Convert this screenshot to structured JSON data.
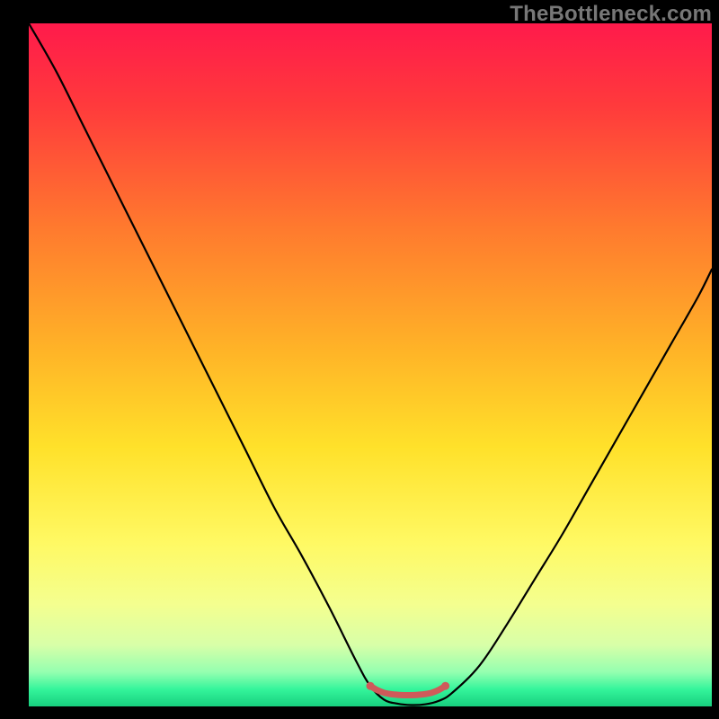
{
  "watermark": "TheBottleneck.com",
  "chart_data": {
    "type": "line",
    "title": "",
    "xlabel": "",
    "ylabel": "",
    "xlim": [
      0,
      100
    ],
    "ylim": [
      0,
      100
    ],
    "background_gradient": {
      "stops": [
        {
          "pos": 0.0,
          "color": "#ff1a4b"
        },
        {
          "pos": 0.12,
          "color": "#ff3a3c"
        },
        {
          "pos": 0.3,
          "color": "#ff7a2e"
        },
        {
          "pos": 0.48,
          "color": "#ffb427"
        },
        {
          "pos": 0.62,
          "color": "#ffe12a"
        },
        {
          "pos": 0.76,
          "color": "#fff963"
        },
        {
          "pos": 0.85,
          "color": "#f4ff8f"
        },
        {
          "pos": 0.91,
          "color": "#d8ffa8"
        },
        {
          "pos": 0.95,
          "color": "#94ffb0"
        },
        {
          "pos": 0.975,
          "color": "#34f59b"
        },
        {
          "pos": 1.0,
          "color": "#17cf7e"
        }
      ]
    },
    "series": [
      {
        "name": "bottleneck-v",
        "stroke": "#000000",
        "width": 2.2,
        "x": [
          0.0,
          4.0,
          8.0,
          12.0,
          16.0,
          20.0,
          24.0,
          28.0,
          32.0,
          36.0,
          40.0,
          44.0,
          48.0,
          50.0,
          52.0,
          54.0,
          56.0,
          58.0,
          60.0,
          62.0,
          66.0,
          70.0,
          74.0,
          78.0,
          82.0,
          86.0,
          90.0,
          94.0,
          98.0,
          100.0
        ],
        "y": [
          100.0,
          93.0,
          85.0,
          77.0,
          69.0,
          61.0,
          53.0,
          45.0,
          37.0,
          29.0,
          22.0,
          14.5,
          6.5,
          3.0,
          1.0,
          0.4,
          0.2,
          0.3,
          0.8,
          2.0,
          6.0,
          12.0,
          18.5,
          25.0,
          32.0,
          39.0,
          46.0,
          53.0,
          60.0,
          64.0
        ]
      },
      {
        "name": "valley-floor-marker",
        "stroke": "#cf5a5a",
        "width": 7.0,
        "x": [
          50.0,
          51.0,
          52.0,
          53.0,
          54.0,
          55.0,
          56.0,
          57.0,
          58.0,
          59.0,
          60.0,
          61.0
        ],
        "y": [
          3.0,
          2.4,
          2.0,
          1.8,
          1.7,
          1.65,
          1.65,
          1.7,
          1.8,
          2.0,
          2.4,
          3.0
        ]
      }
    ]
  }
}
